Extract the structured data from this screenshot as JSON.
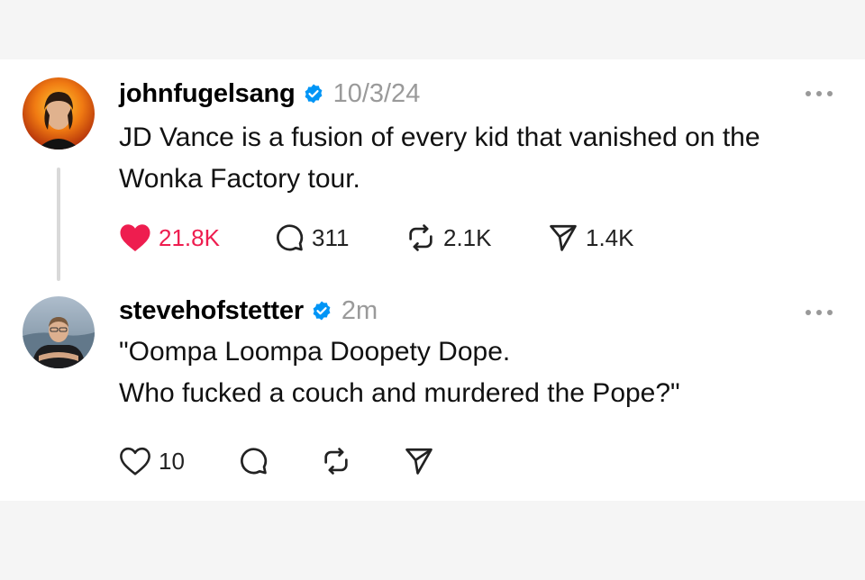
{
  "posts": [
    {
      "username": "johnfugelsang",
      "timestamp": "10/3/24",
      "lines": [
        "JD Vance is a fusion of every kid that vanished on the",
        "Wonka Factory tour."
      ],
      "likes": "21.8K",
      "replies": "311",
      "reposts": "2.1K",
      "shares": "1.4K",
      "liked": true
    },
    {
      "username": "stevehofstetter",
      "timestamp": "2m",
      "lines": [
        "\"Oompa Loompa Doopety Dope.",
        "Who fucked a couch and murdered the Pope?\""
      ],
      "likes": "10",
      "liked": false
    }
  ],
  "colors": {
    "verified": "#0095f6",
    "like_active": "#ee1d4f",
    "timestamp": "#9a9a9a"
  },
  "icons": [
    "verified-badge-icon",
    "more-icon",
    "heart-icon",
    "comment-icon",
    "repost-icon",
    "share-icon"
  ]
}
